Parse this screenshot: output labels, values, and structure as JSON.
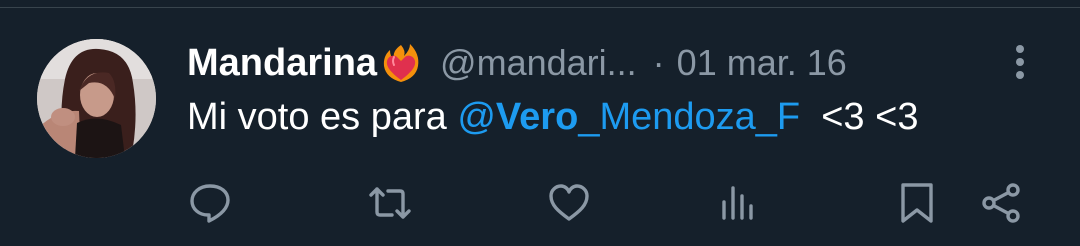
{
  "tweet": {
    "display_name": "Mandarina",
    "name_emoji": "heart-on-fire",
    "handle": "@mandari...",
    "separator": "·",
    "date": "01 mar. 16",
    "text_prefix": "Mi voto es para ",
    "mention_at": "@",
    "mention_bold": "Vero",
    "mention_rest": "_Mendoza_F",
    "text_suffix": "  <3 <3"
  },
  "actions": {
    "reply": "reply-icon",
    "retweet": "retweet-icon",
    "like": "heart-icon",
    "views": "views-icon",
    "bookmark": "bookmark-icon",
    "share": "share-icon"
  },
  "colors": {
    "background": "#15202b",
    "text": "#ffffff",
    "secondary": "#8b98a5",
    "link": "#1d9bf0"
  }
}
